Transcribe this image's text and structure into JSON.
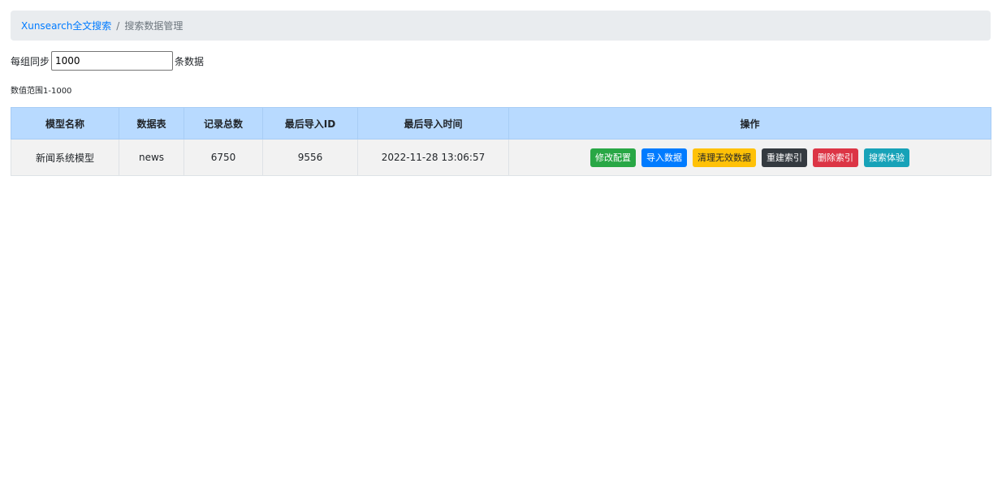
{
  "breadcrumb": {
    "home_label": "Xunsearch全文搜索",
    "separator": "/",
    "current_label": "搜索数据管理"
  },
  "sync": {
    "prefix_label": "每组同步",
    "value": "1000",
    "suffix_label": "条数据"
  },
  "range_note": "数值范围1-1000",
  "table": {
    "headers": [
      "模型名称",
      "数据表",
      "记录总数",
      "最后导入ID",
      "最后导入时间",
      "操作"
    ],
    "rows": [
      {
        "model_name": "新闻系统模型",
        "data_table": "news",
        "total_records": "6750",
        "last_import_id": "9556",
        "last_import_time": "2022-11-28 13:06:57",
        "actions": [
          {
            "label": "修改配置",
            "color": "#28a745"
          },
          {
            "label": "导入数据",
            "color": "#007bff"
          },
          {
            "label": "清理无效数据",
            "color": "#ffc107"
          },
          {
            "label": "重建索引",
            "color": "#343a40"
          },
          {
            "label": "删除索引",
            "color": "#dc3545"
          },
          {
            "label": "搜索体验",
            "color": "#17a2b8"
          }
        ]
      }
    ]
  }
}
